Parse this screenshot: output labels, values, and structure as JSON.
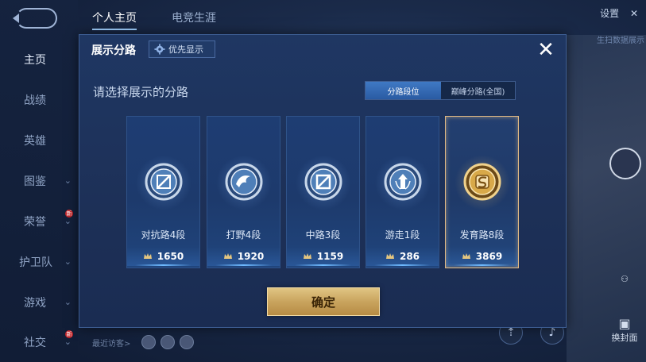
{
  "background": {
    "sidebar": {
      "items": [
        {
          "label": "主页",
          "active": true
        },
        {
          "label": "战绩"
        },
        {
          "label": "英雄"
        },
        {
          "label": "图鉴",
          "chevron": true
        },
        {
          "label": "荣誉",
          "chevron": true,
          "badge": "新"
        },
        {
          "label": "护卫队",
          "chevron": true
        },
        {
          "label": "游戏",
          "chevron": true
        },
        {
          "label": "社交",
          "chevron": true,
          "badge": "新"
        }
      ]
    },
    "top_tabs": [
      {
        "label": "个人主页",
        "active": true
      },
      {
        "label": "电竞生涯"
      }
    ],
    "settings_label": "设置",
    "settings_close": "✕",
    "side_text": "生扫数据展示",
    "right_bottom_label": "换封面",
    "recent_visitors_label": "最近访客>"
  },
  "modal": {
    "title": "展示分路",
    "priority_button_label": "优先显示",
    "close_symbol": "✕",
    "prompt": "请选择展示的分路",
    "toggle": {
      "options": [
        {
          "label": "分路段位",
          "active": true
        },
        {
          "label": "巅峰分路(全国)",
          "active": false
        }
      ]
    },
    "cards": [
      {
        "rank_label": "对抗路4段",
        "score": "1650",
        "icon": "clash-lane-emblem",
        "selected": false
      },
      {
        "rank_label": "打野4段",
        "score": "1920",
        "icon": "jungle-emblem",
        "selected": false
      },
      {
        "rank_label": "中路3段",
        "score": "1159",
        "icon": "mid-lane-emblem",
        "selected": false
      },
      {
        "rank_label": "游走1段",
        "score": "286",
        "icon": "roam-emblem",
        "selected": false
      },
      {
        "rank_label": "发育路8段",
        "score": "3869",
        "icon": "farm-lane-emblem",
        "selected": true
      }
    ],
    "confirm_label": "确定"
  },
  "colors": {
    "accent_gold": "#d9b46a",
    "selected_border": "#e1b984",
    "toggle_active": "#3a6fb8",
    "panel_bg": "#1e355f"
  }
}
